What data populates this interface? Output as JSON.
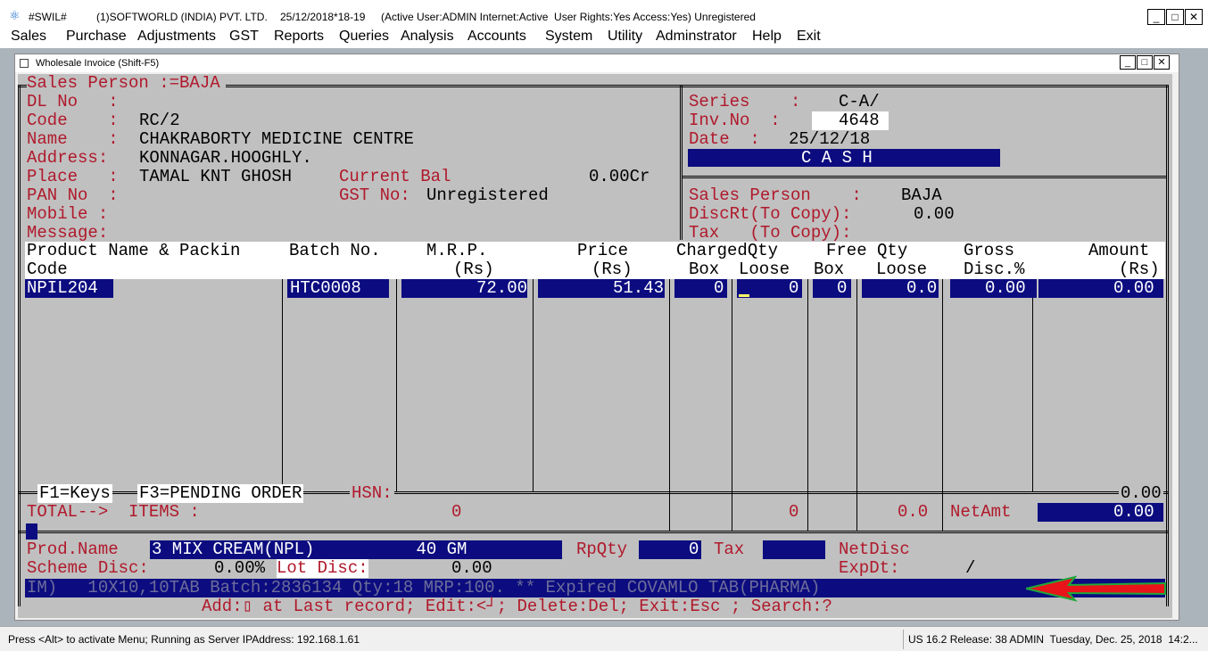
{
  "titlebar": {
    "app": "#SWIL#",
    "company": "(1)SOFTWORLD (INDIA) PVT. LTD.",
    "date": "25/12/2018*18-19",
    "status": "(Active User:ADMIN Internet:Active  User Rights:Yes Access:Yes) Unregistered"
  },
  "menu": [
    "Sales",
    "Purchase",
    "Adjustments",
    "GST",
    "Reports",
    "Queries",
    "Analysis",
    "Accounts",
    "System",
    "Utility",
    "Adminstrator",
    "Help",
    "Exit"
  ],
  "child_window": {
    "title": "Wholesale Invoice (Shift-F5)"
  },
  "header": {
    "sales_person_title": "Sales Person :=BAJA",
    "dl_label": "DL No   :",
    "code_label": "Code    :",
    "code_value": "RC/2",
    "name_label": "Name    :",
    "name_value": "CHAKRABORTY MEDICINE CENTRE",
    "address_label": "Address:",
    "address_value": "KONNAGAR.HOOGHLY.",
    "place_label": "Place   :",
    "place_value": "TAMAL KNT GHOSH",
    "current_bal_label": "Current Bal",
    "current_bal_value": "0.00Cr",
    "pan_label": "PAN No  :",
    "gst_label": "GST No:",
    "gst_value": "Unregistered",
    "mobile_label": "Mobile :",
    "message_label": "Message:"
  },
  "right_panel": {
    "series_label": "Series    :",
    "series_value": "C-A/",
    "inv_label": "Inv.No  :",
    "inv_value": "4648",
    "date_label": "Date  :",
    "date_value": "25/12/18",
    "mode": "C A S H",
    "sales_person_label": "Sales Person    :",
    "sales_person_value": "BAJA",
    "discrt_label": "DiscRt(To Copy):",
    "discrt_value": "0.00",
    "tax_label": "Tax   (To Copy):"
  },
  "table": {
    "headers": {
      "product_1": "Product Name & Packin",
      "product_2": "Code",
      "batch": "Batch No.",
      "mrp_1": "M.R.P.",
      "mrp_2": "(Rs)",
      "price_1": "Price",
      "price_2": "(Rs)",
      "charged_1": "ChargedQty",
      "charged_box": "Box",
      "charged_loose": "Loose",
      "free_1": "Free Qty",
      "free_box": "Box",
      "free_loose": "Loose",
      "gross_1": "Gross",
      "gross_2": "Disc.%",
      "amount_1": "Amount",
      "amount_2": "(Rs)"
    },
    "row": {
      "product": "NPIL204",
      "batch": "HTC0008",
      "mrp": "72.00",
      "price": "51.43",
      "box": "0",
      "loose": "0",
      "free_box": "0",
      "free_loose": "0.0",
      "gross": "0.00",
      "amount": "0.00"
    }
  },
  "footer_bar": {
    "f1": "F1=Keys",
    "f3": "F3=PENDING ORDER",
    "hsn": "HSN:",
    "right_value": "0.00"
  },
  "totals": {
    "label": "TOTAL-->  ITEMS :",
    "items": "0",
    "loose": "0",
    "free_loose": "0.0",
    "netamt_label": "NetAmt",
    "netamt": "0.00"
  },
  "prod_panel": {
    "prod_name_label": "Prod.Name",
    "prod_name_value": "3 MIX CREAM(NPL)          40 GM",
    "rpqty_label": "RpQty",
    "rpqty_value": "0",
    "tax_label": "Tax",
    "netdisc_label": "NetDisc",
    "scheme_label": "Scheme Disc:",
    "scheme_value": "0.00%",
    "lot_label": "Lot Disc:",
    "lot_value": "0.00",
    "expdt_label": "ExpDt:",
    "expdt_value": "/",
    "info_line": "IM)   10X10,10TAB Batch:2836134 Qty:18 MRP:100. ** Expired COVAMLO TAB(PHARMA)",
    "key_line": "Add:▯ at Last record; Edit:<┘; Delete:Del; Exit:Esc ; Search:?"
  },
  "statusbar": {
    "left": "Press <Alt> to activate Menu; Running as Server IPAddress: 192.168.1.61",
    "right": "US 16.2 Release: 38 ADMIN  Tuesday, Dec. 25, 2018  14:2..."
  },
  "colors": {
    "label_red": "#b0192b",
    "field_navy": "#0c0c80",
    "terminal_gray": "#c0c0c0",
    "arrow_red": "#e8141a",
    "arrow_green": "#1fa83a"
  }
}
